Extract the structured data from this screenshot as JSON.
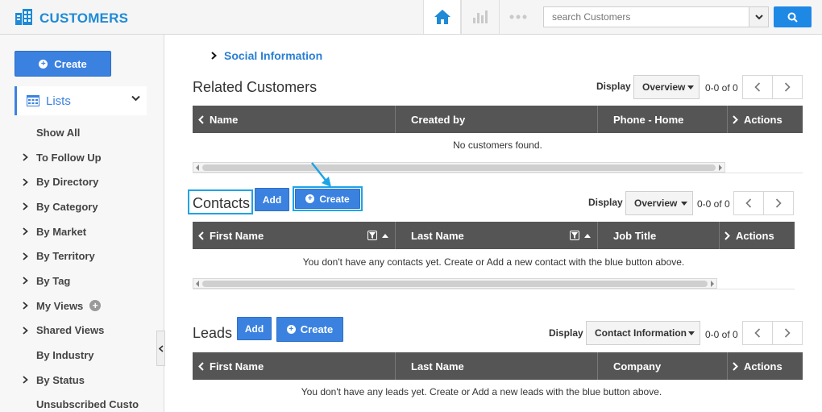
{
  "app": {
    "title": "CUSTOMERS"
  },
  "topbar": {
    "icons": [
      "home-icon",
      "bar-chart-icon",
      "more-dots-icon"
    ],
    "search": {
      "placeholder": "search Customers"
    }
  },
  "sidebar": {
    "create_label": "Create",
    "lists_label": "Lists",
    "items": [
      {
        "label": "Show All",
        "arrow": false
      },
      {
        "label": "To Follow Up",
        "arrow": true
      },
      {
        "label": "By Directory",
        "arrow": true
      },
      {
        "label": "By Category",
        "arrow": true
      },
      {
        "label": "By Market",
        "arrow": true
      },
      {
        "label": "By Territory",
        "arrow": true
      },
      {
        "label": "By Tag",
        "arrow": true
      },
      {
        "label": "My Views",
        "arrow": true
      },
      {
        "label": "Shared Views",
        "arrow": true
      },
      {
        "label": "By Industry",
        "arrow": false
      },
      {
        "label": "By Status",
        "arrow": true
      },
      {
        "label": "Unsubscribed Custo",
        "arrow": false
      }
    ]
  },
  "main": {
    "social_link": "Social Information",
    "related": {
      "title": "Related Customers",
      "display_label": "Display",
      "display_value": "Overview",
      "count": "0-0 of 0",
      "columns": [
        "Name",
        "Created by",
        "Phone - Home",
        "Actions"
      ],
      "empty": "No customers found."
    },
    "contacts": {
      "title": "Contacts",
      "add_label": "Add",
      "create_label": "Create",
      "display_label": "Display",
      "display_value": "Overview",
      "count": "0-0 of 0",
      "columns": [
        "First Name",
        "Last Name",
        "Job Title",
        "Actions"
      ],
      "empty": "You don't have any contacts yet. Create or Add a new contact with the blue button above."
    },
    "leads": {
      "title": "Leads",
      "add_label": "Add",
      "create_label": "Create",
      "display_label": "Display",
      "display_value": "Contact Information",
      "count": "0-0 of 0",
      "columns": [
        "First Name",
        "Last Name",
        "Company",
        "Actions"
      ],
      "empty": "You don't have any leads yet. Create or Add a new leads with the blue button above."
    }
  },
  "colors": {
    "accent": "#3b82e0",
    "brand": "#1f8ad6",
    "header_bg": "#555555",
    "highlight": "#1ea4e6"
  }
}
